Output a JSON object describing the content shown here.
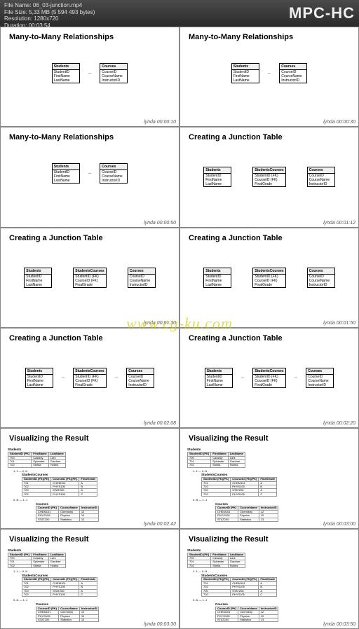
{
  "header": {
    "file_name_lbl": "File Name:",
    "file_name": "06_03-junction.mp4",
    "file_size_lbl": "File Size:",
    "file_size": "5,33 MB (5 594 493 bytes)",
    "resolution_lbl": "Resolution:",
    "resolution": "1280x720",
    "duration_lbl": "Duration:",
    "duration": "00:03:54",
    "app": "MPC-HC"
  },
  "watermark": "www.cg-ku.com",
  "brand_suffix": "lynda",
  "slides": [
    {
      "title": "Many-to-Many Relationships",
      "tables": [
        "Students",
        "Courses"
      ],
      "ts": "00:00:10",
      "conn": "0..N — 0..N",
      "type": "diagram"
    },
    {
      "title": "Many-to-Many Relationships",
      "tables": [
        "Students",
        "Courses"
      ],
      "ts": "00:00:30",
      "conn": "0..N — 0..N",
      "type": "diagram"
    },
    {
      "title": "Many-to-Many Relationships",
      "tables": [
        "Students",
        "Courses"
      ],
      "ts": "00:00:50",
      "conn": "0..N — 0..N",
      "type": "diagram"
    },
    {
      "title": "Creating a Junction Table",
      "tables": [
        "Students",
        "StudentsCourses",
        "Courses"
      ],
      "ts": "00:01:12",
      "conn": "",
      "type": "diagram"
    },
    {
      "title": "Creating a Junction Table",
      "tables": [
        "Students",
        "StudentsCourses",
        "Courses"
      ],
      "ts": "00:01:30",
      "conn": "",
      "type": "diagram"
    },
    {
      "title": "Creating a Junction Table",
      "tables": [
        "Students",
        "StudentsCourses",
        "Courses"
      ],
      "ts": "00:01:50",
      "conn": "",
      "type": "diagram"
    },
    {
      "title": "Creating a Junction Table",
      "tables": [
        "Students",
        "StudentsCourses",
        "Courses"
      ],
      "ts": "00:02:08",
      "conn": "1..1 — 0..N  1..1 — 0..N",
      "type": "diagram"
    },
    {
      "title": "Creating a Junction Table",
      "tables": [
        "Students",
        "StudentsCourses",
        "Courses"
      ],
      "ts": "00:02:20",
      "conn": "1..1 — 0..N  1..1 — 0..N",
      "type": "diagram"
    },
    {
      "title": "Visualizing the Result",
      "ts": "00:02:42",
      "type": "result"
    },
    {
      "title": "Visualizing the Result",
      "ts": "00:03:00",
      "type": "result"
    },
    {
      "title": "Visualizing the Result",
      "ts": "00:03:30",
      "type": "result"
    },
    {
      "title": "Visualizing the Result",
      "ts": "00:03:50",
      "type": "result"
    }
  ],
  "db": {
    "Students": {
      "rows": [
        "StudentID",
        "FirstName",
        "LastName"
      ]
    },
    "Courses": {
      "rows": [
        "CourseID",
        "CourseName",
        "InstructorID"
      ]
    },
    "StudentsCourses": {
      "rows": [
        "StudentID (FK)",
        "CourseID (FK)",
        "FinalGrade"
      ]
    }
  },
  "result": {
    "students": {
      "name": "Students",
      "headers": [
        "StudentID (PK)",
        "FirstName",
        "LastName"
      ],
      "rows": [
        [
          "700",
          "Cassidy",
          "Lark"
        ],
        [
          "701",
          "Sylvester",
          "Gardner"
        ],
        [
          "702",
          "Sheila",
          "Hobbs"
        ]
      ]
    },
    "rel1": "1..1 — 0..N",
    "sc": {
      "name": "StudentsCourses",
      "headers": [
        "StudentID (FK)(PK)",
        "CourseID (FK)(PK)",
        "FinalGrade"
      ],
      "rows": [
        [
          "701",
          "CHEM101",
          "A"
        ],
        [
          "702",
          "PHYS105",
          "B"
        ],
        [
          "700",
          "STAT200",
          "A"
        ],
        [
          "702",
          "PHYS105",
          "C"
        ]
      ]
    },
    "rel2": "0..N — 1..1",
    "courses": {
      "name": "Courses",
      "headers": [
        "CourseID (PK)",
        "CourseName",
        "InstructorID"
      ],
      "rows": [
        [
          "CHEM101",
          "Chemistry",
          "12"
        ],
        [
          "PHYS105",
          "Physics",
          "10"
        ],
        [
          "STAT200",
          "Statistics",
          "13"
        ]
      ]
    }
  }
}
